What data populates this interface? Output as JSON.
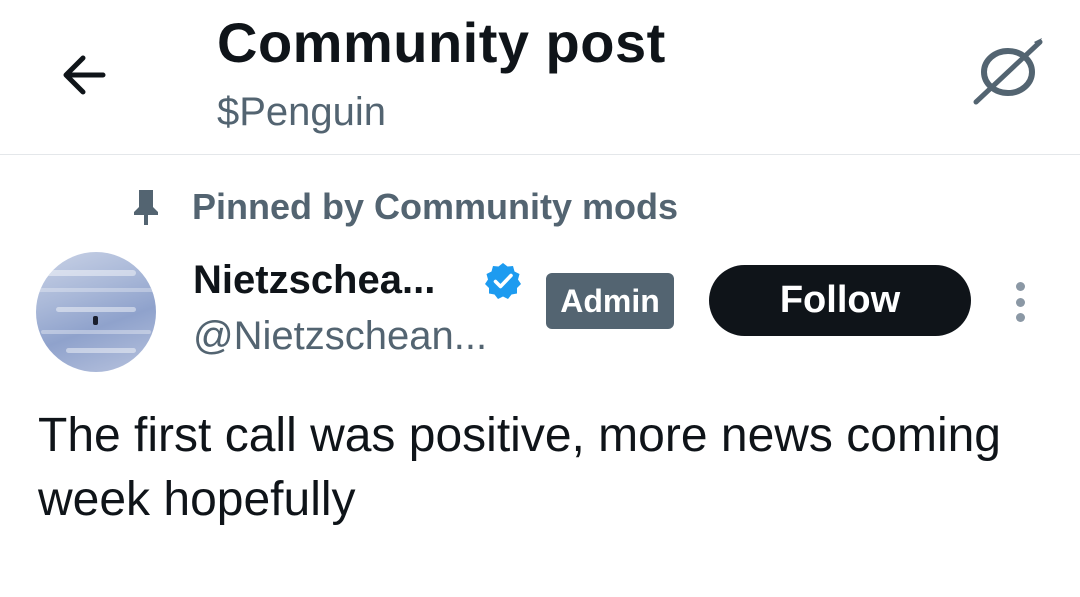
{
  "header": {
    "back_icon": "arrow-left-icon",
    "title": "Community post",
    "subtitle": "$Penguin",
    "action_icon": "no-grok-icon"
  },
  "pinned": {
    "icon": "pin-icon",
    "text": "Pinned by Community mods"
  },
  "post": {
    "author_name": "Nietzschea...",
    "verified_icon": "verified-badge-icon",
    "verified_color": "#1d9bf0",
    "handle": "@Nietzschean...",
    "role_badge": "Admin",
    "follow_label": "Follow",
    "more_icon": "vertical-ellipsis-icon",
    "text": "The first call was positive, more news coming week hopefully"
  },
  "colors": {
    "primary_text": "#0f1419",
    "secondary_text": "#536471",
    "follow_bg": "#0f1419",
    "badge_bg": "#536471",
    "divider": "#e4e7ea"
  }
}
